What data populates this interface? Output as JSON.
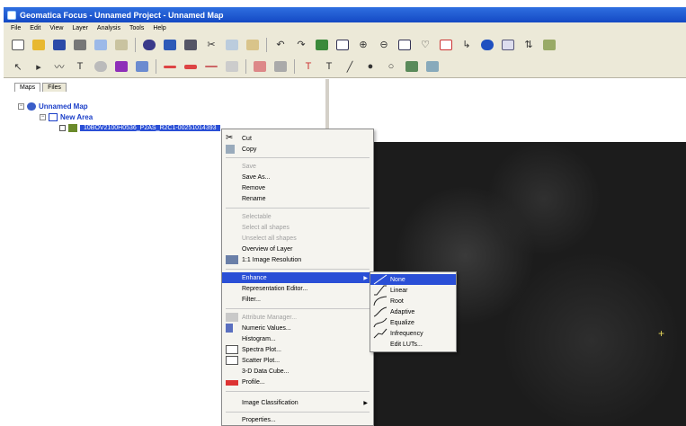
{
  "window": {
    "title": "Geomatica Focus - Unnamed Project - Unnamed Map"
  },
  "menubar": [
    "File",
    "Edit",
    "View",
    "Layer",
    "Analysis",
    "Tools",
    "Help"
  ],
  "left_pane": {
    "tabs": [
      "Maps",
      "Files"
    ],
    "tree": {
      "map": "Unnamed Map",
      "area": "New Area",
      "layer": "10BOV2100H0536_P2AS_R2C1-00251014393"
    }
  },
  "context_menu": {
    "items": [
      {
        "label": "Cut",
        "enabled": true,
        "icon": "scissors-icon"
      },
      {
        "label": "Copy",
        "enabled": true,
        "icon": "copy-icon"
      },
      {
        "label": "Save",
        "enabled": false
      },
      {
        "label": "Save As...",
        "enabled": true
      },
      {
        "label": "Remove",
        "enabled": true
      },
      {
        "label": "Rename",
        "enabled": true
      },
      {
        "label": "Selectable",
        "enabled": false
      },
      {
        "label": "Select all shapes",
        "enabled": false
      },
      {
        "label": "Unselect all shapes",
        "enabled": false
      },
      {
        "label": "Overview of Layer",
        "enabled": true
      },
      {
        "label": "1:1 Image Resolution",
        "enabled": true,
        "icon": "resolution-icon"
      },
      {
        "label": "Enhance",
        "enabled": true,
        "submenu": true,
        "highlight": true
      },
      {
        "label": "Representation Editor...",
        "enabled": true
      },
      {
        "label": "Filter...",
        "enabled": true
      },
      {
        "label": "Attribute Manager...",
        "enabled": false,
        "icon": "attribute-manager-icon"
      },
      {
        "label": "Numeric Values...",
        "enabled": true,
        "icon": "numeric-values-icon"
      },
      {
        "label": "Histogram...",
        "enabled": true
      },
      {
        "label": "Spectra Plot...",
        "enabled": true,
        "icon": "spectra-plot-icon"
      },
      {
        "label": "Scatter Plot...",
        "enabled": true,
        "icon": "scatter-plot-icon"
      },
      {
        "label": "3-D Data Cube...",
        "enabled": true
      },
      {
        "label": "Profile...",
        "enabled": true,
        "icon": "profile-icon"
      },
      {
        "label": "Image Classification",
        "enabled": true,
        "submenu": true
      },
      {
        "label": "Properties...",
        "enabled": true
      }
    ]
  },
  "enhance_submenu": {
    "items": [
      {
        "label": "None",
        "highlight": true
      },
      {
        "label": "Linear"
      },
      {
        "label": "Root"
      },
      {
        "label": "Adaptive"
      },
      {
        "label": "Equalize"
      },
      {
        "label": "Infrequency"
      },
      {
        "label": "Edit LUTs..."
      }
    ]
  },
  "colors": {
    "titlebar": "#1e57d4",
    "chrome": "#ece9d8",
    "highlight": "#2a4fd6",
    "imagery": "#1c1c1c",
    "crosshair": "#e8d85a"
  }
}
